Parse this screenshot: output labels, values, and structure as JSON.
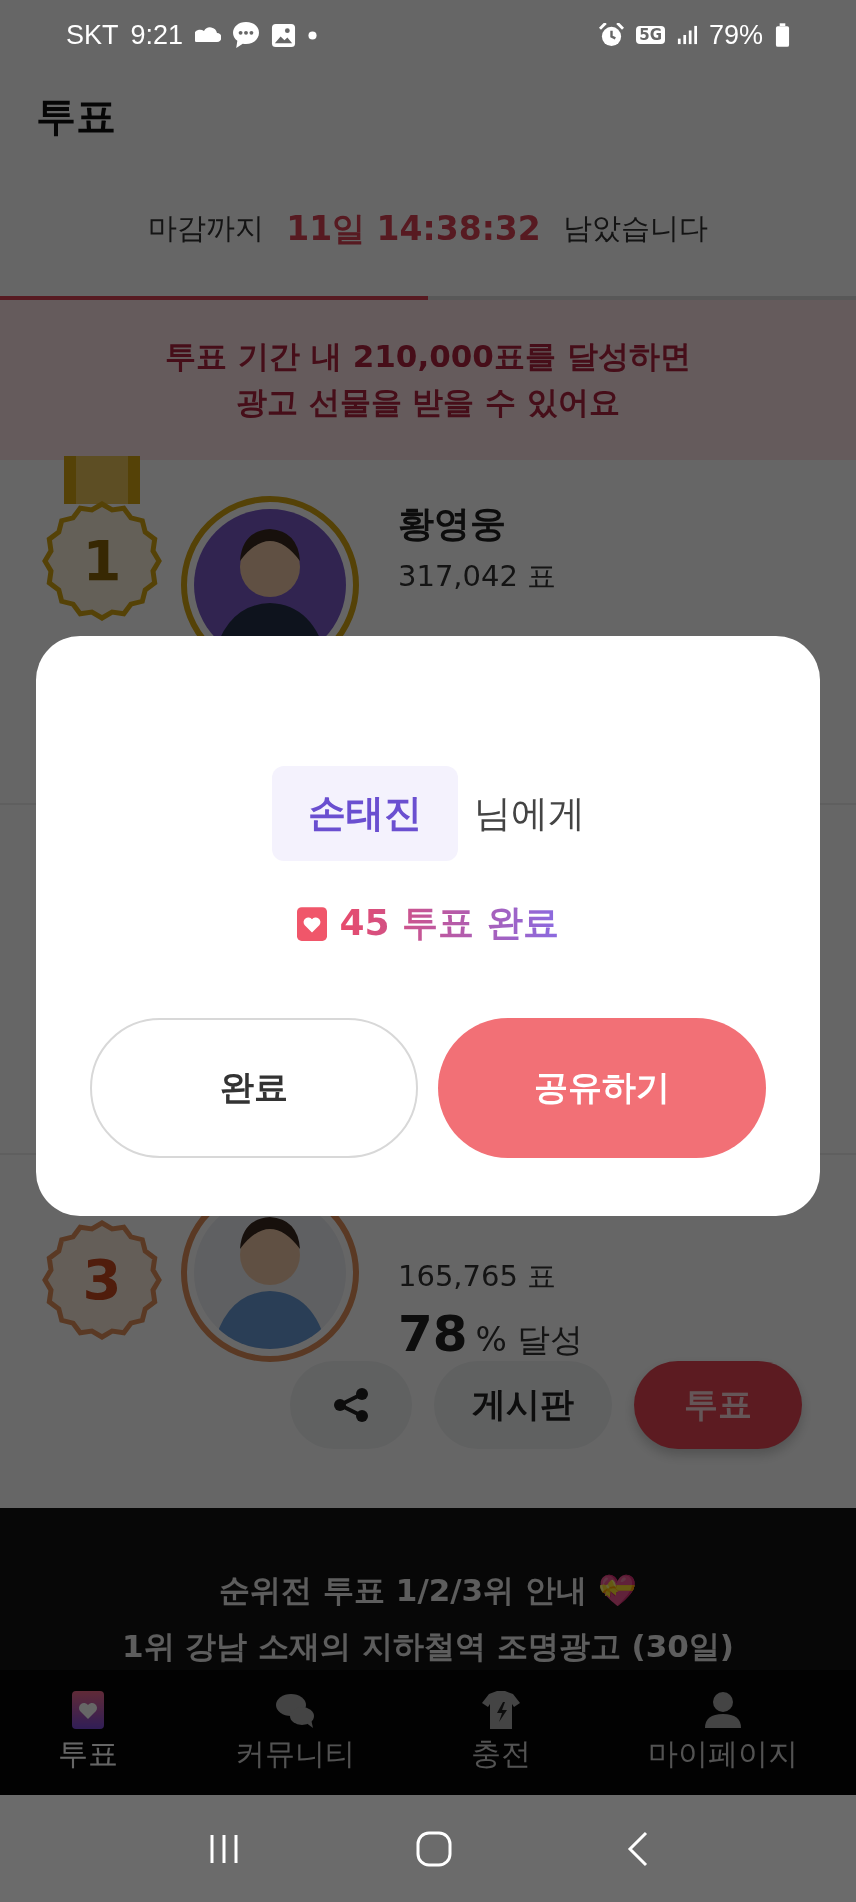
{
  "status_bar": {
    "carrier": "SKT",
    "time": "9:21",
    "network": "5G",
    "battery": "79%"
  },
  "header": {
    "title": "투표"
  },
  "countdown": {
    "prefix": "마감까지",
    "remaining": "11일 14:38:32",
    "suffix": "남았습니다",
    "level": 0.5
  },
  "goal_banner": {
    "lines": [
      "투표 기간 내 210,000표를 달성하면",
      "광고 선물을 받을 수 있어요"
    ]
  },
  "ranking": [
    {
      "rank": "1",
      "kind": "gold",
      "name": "황영웅",
      "votes": "317,042 표"
    },
    {
      "rank": "3",
      "kind": "bronze",
      "votes": "165,765 표",
      "percent": "78",
      "percent_unit": "% 달성",
      "actions": [
        {
          "kind": "share"
        },
        {
          "kind": "board",
          "label": "게시판"
        },
        {
          "kind": "vote",
          "label": "투표"
        }
      ]
    }
  ],
  "promo": {
    "lines": [
      "순위전 투표 1/2/3위 안내 💝",
      "1위 강남 소재의 지하철역 조명광고 (30일)"
    ]
  },
  "bottom_nav": [
    {
      "kind": "vote",
      "label": "투표",
      "selected": true
    },
    {
      "kind": "community",
      "label": "커뮤니티",
      "selected": false
    },
    {
      "kind": "charge",
      "label": "충전",
      "selected": false
    },
    {
      "kind": "mypage",
      "label": "마이페이지",
      "selected": false
    }
  ],
  "dialog": {
    "recipient": "손태진",
    "recipient_suffix": "님에게",
    "result": "45 투표 완료",
    "buttons": [
      {
        "kind": "secondary",
        "label": "완료"
      },
      {
        "kind": "primary",
        "label": "공유하기"
      }
    ]
  }
}
